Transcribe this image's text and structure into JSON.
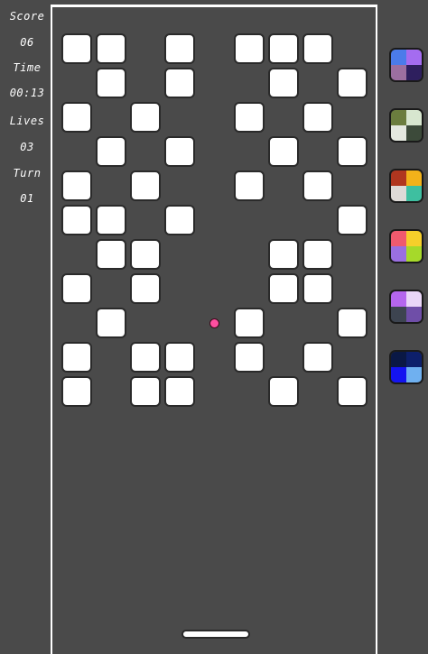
{
  "hud": {
    "score_label": "Score",
    "score_value": "06",
    "time_label": "Time",
    "time_value": "00:13",
    "lives_label": "Lives",
    "lives_value": "03",
    "turn_label": "Turn",
    "turn_value": "01"
  },
  "colors": {
    "background": "#4a4a4a",
    "brick": "#ffffff",
    "ball": "#ff4fa0",
    "paddle": "#ffffff"
  },
  "brick_grid": {
    "rows": [
      [
        1,
        1,
        0,
        1,
        0,
        1,
        1,
        1,
        0
      ],
      [
        0,
        1,
        0,
        1,
        0,
        0,
        1,
        0,
        1
      ],
      [
        1,
        0,
        1,
        0,
        0,
        1,
        0,
        1,
        0
      ],
      [
        0,
        1,
        0,
        1,
        0,
        0,
        1,
        0,
        1
      ],
      [
        1,
        0,
        1,
        0,
        0,
        1,
        0,
        1,
        0
      ],
      [
        1,
        1,
        0,
        1,
        0,
        0,
        0,
        0,
        1
      ],
      [
        0,
        1,
        1,
        0,
        0,
        0,
        1,
        1,
        0
      ],
      [
        1,
        0,
        1,
        0,
        0,
        0,
        1,
        1,
        0
      ],
      [
        0,
        1,
        0,
        0,
        0,
        1,
        0,
        0,
        1
      ],
      [
        1,
        0,
        1,
        1,
        0,
        1,
        0,
        1,
        0
      ],
      [
        1,
        0,
        1,
        1,
        0,
        0,
        1,
        0,
        1
      ]
    ]
  },
  "palettes": [
    {
      "name": "palette-1",
      "colors": [
        "#4b7bea",
        "#a46cf0",
        "#9c6fa0",
        "#2e1f5e"
      ]
    },
    {
      "name": "palette-2",
      "colors": [
        "#6b7d3e",
        "#d7e6cf",
        "#e4e8df",
        "#3c4a3a"
      ]
    },
    {
      "name": "palette-3",
      "colors": [
        "#b0361f",
        "#f2b21a",
        "#dedad7",
        "#3ebfa0"
      ]
    },
    {
      "name": "palette-4",
      "colors": [
        "#f05a6e",
        "#f6cf2a",
        "#9a6fe0",
        "#a6d92a"
      ]
    },
    {
      "name": "palette-5",
      "colors": [
        "#b566ee",
        "#e9d6f7",
        "#3d4450",
        "#6f4ea8"
      ]
    },
    {
      "name": "palette-6",
      "colors": [
        "#0a1845",
        "#0d1f6b",
        "#1414f0",
        "#6fb0f0"
      ]
    }
  ]
}
